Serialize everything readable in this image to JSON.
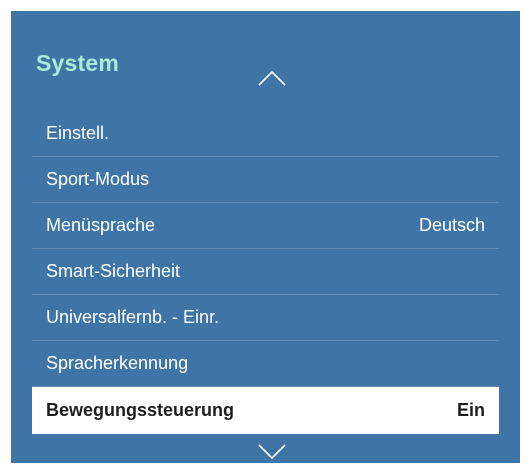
{
  "menu": {
    "title": "System",
    "items": [
      {
        "label": "Einstell.",
        "value": ""
      },
      {
        "label": "Sport-Modus",
        "value": ""
      },
      {
        "label": "Menüsprache",
        "value": "Deutsch"
      },
      {
        "label": "Smart-Sicherheit",
        "value": ""
      },
      {
        "label": "Universalfernb. - Einr.",
        "value": ""
      },
      {
        "label": "Spracherkennung",
        "value": ""
      },
      {
        "label": "Bewegungssteuerung",
        "value": "Ein"
      }
    ],
    "selected_index": 6
  },
  "colors": {
    "panel_background": "#3f74a7",
    "title": "#a8ecd7",
    "selected_background": "#ffffff",
    "selected_text": "#1e1e1e"
  },
  "icons": {
    "scroll_up": "chevron-up-icon",
    "scroll_down": "chevron-down-icon"
  }
}
